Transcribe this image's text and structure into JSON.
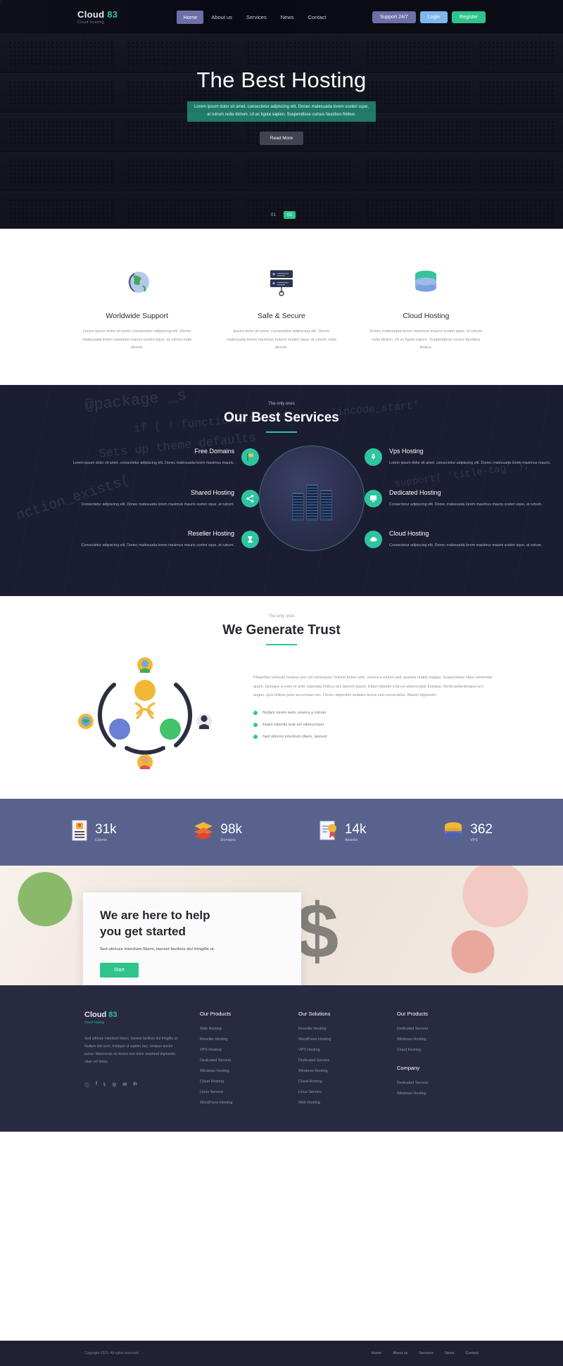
{
  "header": {
    "logo_main": "Cloud",
    "logo_accent": "83",
    "logo_sub": "Cloud hosting",
    "nav": [
      {
        "label": "Home",
        "active": true
      },
      {
        "label": "About us",
        "active": false
      },
      {
        "label": "Services",
        "active": false
      },
      {
        "label": "News",
        "active": false
      },
      {
        "label": "Contact",
        "active": false
      }
    ],
    "buttons": {
      "support": "Support 24/7",
      "login": "Login",
      "register": "Register"
    }
  },
  "hero": {
    "title": "The Best Hosting",
    "paragraph_line1": "Lorem ipsum dolor sit amet, consectetur adipiscing elit. Donec malesuada lorem sceleri sque,",
    "paragraph_line2": "at rutrum nulla dictum. Ut ac ligula sapien. Suspendisse cursus faucibus finibus.",
    "button": "Read More",
    "carousel": [
      {
        "label": "01",
        "active": false
      },
      {
        "label": "02",
        "active": true
      }
    ]
  },
  "features": [
    {
      "icon": "globe-icon",
      "glyph": "🌎",
      "title": "Worldwide Support",
      "text": "Lorem ipsum dolor sit amet, consectetur adipiscing elit. Donec malesuada lorem maximus mauris sceleri sque, at rutrum nulla dictum."
    },
    {
      "icon": "server-icon",
      "glyph": "🗄",
      "title": "Safe & Secure",
      "text": "Ipsum dolor sit amet, consectetur adipiscing elit. Donec malesuada lorem maximus mauris sceleri sque, at rutrum nulla dictum."
    },
    {
      "icon": "database-icon",
      "glyph": "🖫",
      "title": "Cloud Hosting",
      "text": "Donec malesuada lorem maximus mauris sceleri sque, at rutrum nulla dictum. Ut ac ligula sapien. Suspendisse cursus faucibus finibus."
    }
  ],
  "services": {
    "eyebrow": "The only ones",
    "title": "Our Best Services",
    "items": [
      {
        "icon": "flag-icon",
        "glyph": "🚩",
        "title": "Free Domains",
        "text": "Lorem ipsum dolor sit amet, consectetur adipiscing elit. Donec malesuada lorem maximus mauris.",
        "side": "left"
      },
      {
        "icon": "rocket-icon",
        "glyph": "🚀",
        "title": "Vps Hosting",
        "text": "Lorem ipsum dolor sit amet, consectetur adipiscing elit. Donec malesuada lorem maximus mauris.",
        "side": "right"
      },
      {
        "icon": "share-icon",
        "glyph": "🔗",
        "title": "Shared Hosting",
        "text": "Consectetur adipiscing elit. Donec malesuada lorem maximus mauris sceleri sque, at rutrum.",
        "side": "left"
      },
      {
        "icon": "monitor-icon",
        "glyph": "🖥",
        "title": "Dedicated Hosting",
        "text": "Consectetur adipiscing elit. Donec malesuada lorem maximus mauris sceleri sque, at rutrum.",
        "side": "right"
      },
      {
        "icon": "hourglass-icon",
        "glyph": "⌛",
        "title": "Reseller Hosting",
        "text": "Consectetur adipiscing elit. Donec malesuada lorem maximus mauris sceleri sque, at rutrum.",
        "side": "left"
      },
      {
        "icon": "cloud-icon",
        "glyph": "☁",
        "title": "Cloud Hosting",
        "text": "Consectetur adipiscing elit. Donec malesuada lorem maximus mauris sceleri sque, at rutrum.",
        "side": "right"
      }
    ]
  },
  "trust": {
    "eyebrow": "The only ones",
    "title": "We Generate Trust",
    "paragraph": "Phasellus vehicula tempus orci vel consequat. Nullam lorem sem, viverra a rutrum sed, gravida mattis magna. Suspendisse vitae commodo quam. Quisque a enim et ante vulputate finibus nec laoreet ipsum. Etiam lobortis erat vel ullamcorper tristique. Morbi pellentesque orci augue, quis finibus justo accumsan nec. Donec imperdiet sodales lectus sed consectetur. Mauris dignissim.",
    "list": [
      "Nullam lorem sem, viverra a rutrum",
      "Etiam lobortis erat vel ullamcorper",
      "Sed ultrices interdum libero, laoreet"
    ]
  },
  "stats": [
    {
      "icon": "clients-icon",
      "glyph": "📇",
      "number": "31k",
      "label": "Clients"
    },
    {
      "icon": "domains-icon",
      "glyph": "📚",
      "number": "98k",
      "label": "Domains"
    },
    {
      "icon": "awards-icon",
      "glyph": "🎖",
      "number": "14k",
      "label": "Awards"
    },
    {
      "icon": "vps-icon",
      "glyph": "🖫",
      "number": "362",
      "label": "VPS"
    }
  ],
  "cta": {
    "title_line1": "We are here to help",
    "title_line2": "you get started",
    "subtitle": "Sed ultrices interdum libero, laoreet facilisis dui fringilla ut.",
    "button": "Start",
    "decoration": "$"
  },
  "footer": {
    "logo_main": "Cloud",
    "logo_accent": "83",
    "logo_sub": "Cloud hosting",
    "about": "Sed ultrices interdum libero, laoreet facilisis dui fringilla ut. Nullam nisl sem, tristique ut sapien nec, tempus auctor purus. Maecenas eu lectus non dolor euismod dignissim vitae vel tortor.",
    "social": [
      "ⓘ",
      "f",
      "𝕥",
      "◎",
      "✉",
      "in"
    ],
    "columns": [
      {
        "title": "Our Products",
        "items": [
          "Web Hosting",
          "Reseller Hosting",
          "VPS Hosting",
          "Dedicated Servers",
          "Windows Hosting",
          "Cloud Hosting",
          "Linux Servers",
          "WordPress Hosting"
        ]
      },
      {
        "title": "Our Solutions",
        "items": [
          "Reseller Hosting",
          "WordPress Hosting",
          "VPS Hosting",
          "Dedicated Servers",
          "Windows Hosting",
          "Cloud Hosting",
          "Linux Servers",
          "Web Hosting"
        ]
      },
      {
        "title": "Our Products",
        "items": [
          "Dedicated Servers",
          "Windows Hosting",
          "Cloud Hosting"
        ],
        "title2": "Company",
        "items2": [
          "Dedicated Servers",
          "Windows Hosting"
        ]
      }
    ],
    "copyright": "Copyright 2019. All rights reserved.",
    "bottom_nav": [
      "Home",
      "About us",
      "Services",
      "News",
      "Contact"
    ]
  }
}
